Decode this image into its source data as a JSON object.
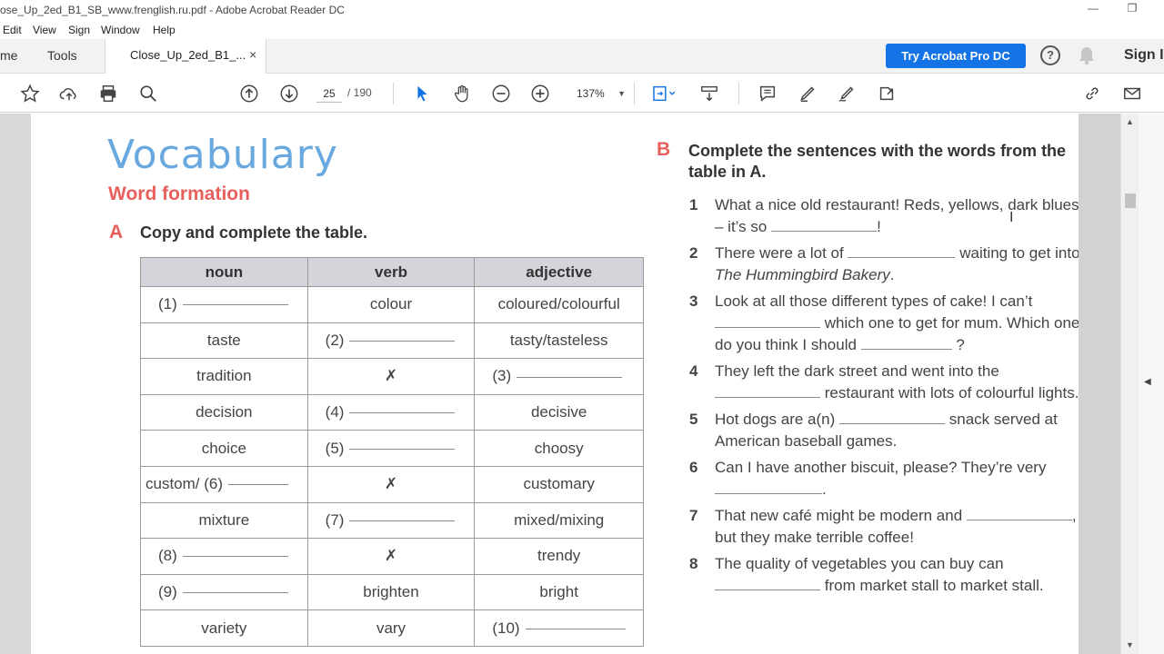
{
  "window": {
    "title": "ose_Up_2ed_B1_SB_www.frenglish.ru.pdf - Adobe Acrobat Reader DC",
    "minimize": "—",
    "restore": "❐"
  },
  "menu": [
    "Edit",
    "View",
    "Sign",
    "Window",
    "Help"
  ],
  "tabs": {
    "home": "me",
    "tools": "Tools",
    "doc": "Close_Up_2ed_B1_...",
    "close": "×"
  },
  "header_right": {
    "try_button": "Try Acrobat Pro DC",
    "help": "?",
    "sign_in": "Sign I"
  },
  "toolbar": {
    "page_current": "25",
    "page_total": "/ 190",
    "zoom": "137%",
    "zoom_caret": "▼"
  },
  "scrollbar": {
    "up": "▲",
    "down": "▼",
    "collapse": "◀"
  },
  "page": {
    "title": "Vocabulary",
    "subtitle": "Word formation",
    "section_a": {
      "letter": "A",
      "instruction": "Copy and complete the table."
    },
    "section_b": {
      "letter": "B",
      "instruction": "Complete the sentences with the words from the table in A."
    },
    "table": {
      "headers": [
        "noun",
        "verb",
        "adjective"
      ],
      "rows": [
        [
          "(1)",
          "colour",
          "coloured/colourful"
        ],
        [
          "taste",
          "(2)",
          "tasty/tasteless"
        ],
        [
          "tradition",
          "✗",
          "(3)"
        ],
        [
          "decision",
          "(4)",
          "decisive"
        ],
        [
          "choice",
          "(5)",
          "choosy"
        ],
        [
          "custom/ (6)",
          "✗",
          "customary"
        ],
        [
          "mixture",
          "(7)",
          "mixed/mixing"
        ],
        [
          "(8)",
          "✗",
          "trendy"
        ],
        [
          "(9)",
          "brighten",
          "bright"
        ],
        [
          "variety",
          "vary",
          "(10)"
        ]
      ]
    },
    "sentences": [
      {
        "num": "1",
        "a": "What a nice old restaurant! Reds, yellows, dark blues – it’s so",
        "b": "!"
      },
      {
        "num": "2",
        "a": "There were a lot of",
        "b": "waiting to get into",
        "c": "The Hummingbird Bakery",
        "d": "."
      },
      {
        "num": "3",
        "a": "Look at all those different types of cake! I can’t",
        "b": "which one to get for mum. Which one do you think I should",
        "c": "?"
      },
      {
        "num": "4",
        "a": "They left the dark street and went into the",
        "b": "restaurant with lots of colourful lights."
      },
      {
        "num": "5",
        "a": "Hot dogs are a(n)",
        "b": "snack served at American baseball games."
      },
      {
        "num": "6",
        "a": "Can I have another biscuit, please? They’re very",
        "b": "."
      },
      {
        "num": "7",
        "a": "That new café might be modern and",
        "b": ", but they make terrible coffee!"
      },
      {
        "num": "8",
        "a": "The quality of vegetables you can buy can",
        "b": "from market stall to market stall."
      }
    ]
  }
}
